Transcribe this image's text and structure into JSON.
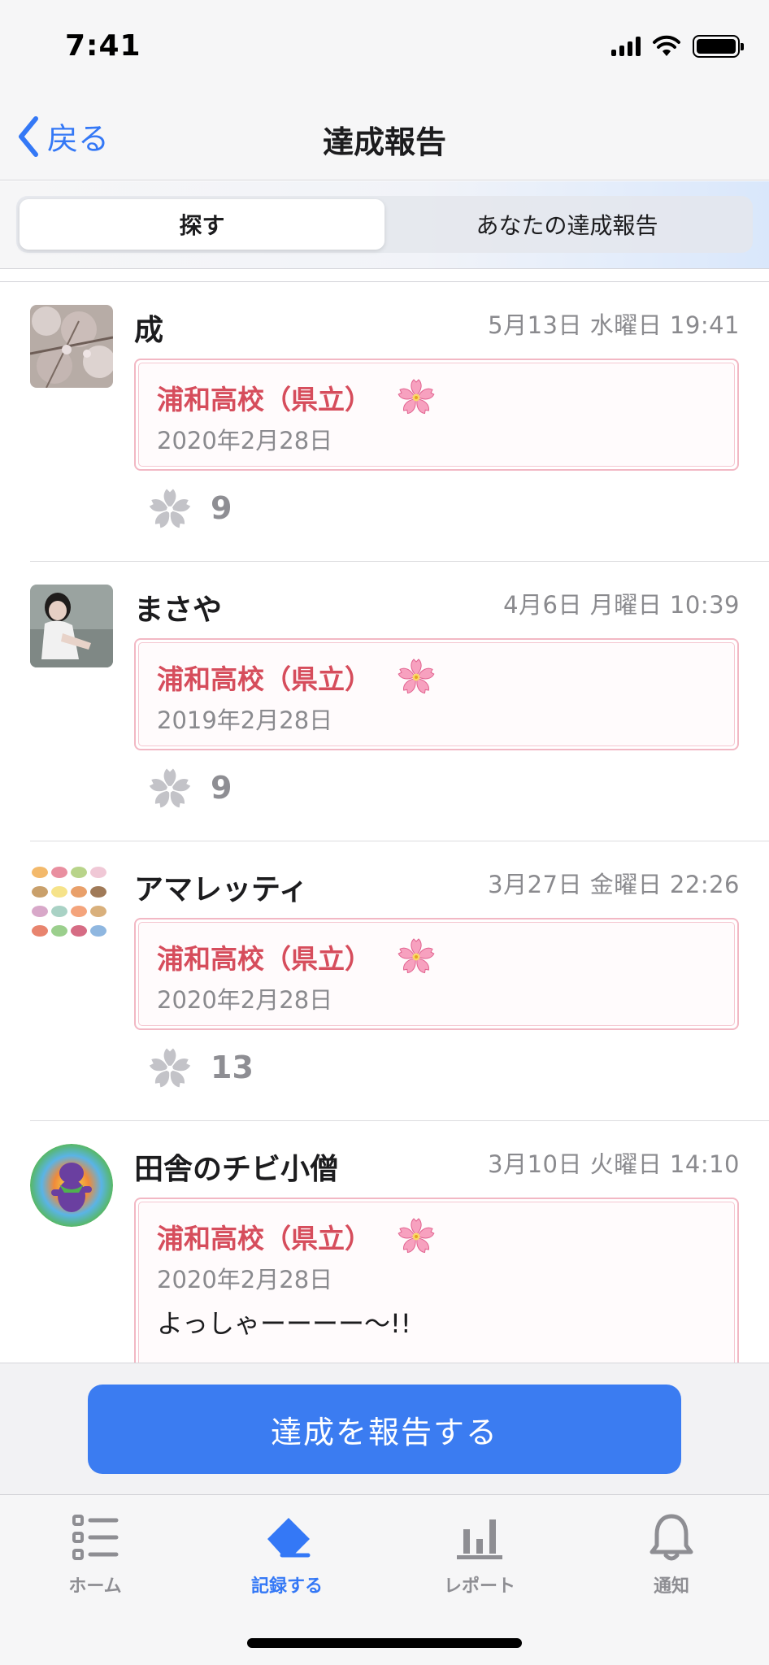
{
  "status_bar": {
    "time": "7:41"
  },
  "nav": {
    "back_label": "戻る",
    "title": "達成報告"
  },
  "segments": [
    {
      "label": "探す",
      "active": true
    },
    {
      "label": "あなたの達成報告",
      "active": false
    }
  ],
  "posts": [
    {
      "username": "成",
      "date": "5月13日 水曜日 19:41",
      "school": "浦和高校（県立）",
      "achieved_date": "2020年2月28日",
      "comment": "",
      "reactions": "9"
    },
    {
      "username": "まさや",
      "date": "4月6日 月曜日 10:39",
      "school": "浦和高校（県立）",
      "achieved_date": "2019年2月28日",
      "comment": "",
      "reactions": "9"
    },
    {
      "username": "アマレッティ",
      "date": "3月27日 金曜日 22:26",
      "school": "浦和高校（県立）",
      "achieved_date": "2020年2月28日",
      "comment": "",
      "reactions": "13"
    },
    {
      "username": "田舎のチビ小僧",
      "date": "3月10日 火曜日 14:10",
      "school": "浦和高校（県立）",
      "achieved_date": "2020年2月28日",
      "comment": "よっしゃーーーー〜!!",
      "reactions": ""
    }
  ],
  "action": {
    "report_button": "達成を報告する"
  },
  "tabs": [
    {
      "label": "ホーム",
      "icon": "list-icon",
      "active": false
    },
    {
      "label": "記録する",
      "icon": "eraser-icon",
      "active": true
    },
    {
      "label": "レポート",
      "icon": "bar-chart-icon",
      "active": false
    },
    {
      "label": "通知",
      "icon": "bell-icon",
      "active": false
    }
  ],
  "colors": {
    "accent": "#3478f6",
    "school_text": "#d64d5c",
    "card_border": "#f2b8c4",
    "button": "#3b7cf1"
  }
}
